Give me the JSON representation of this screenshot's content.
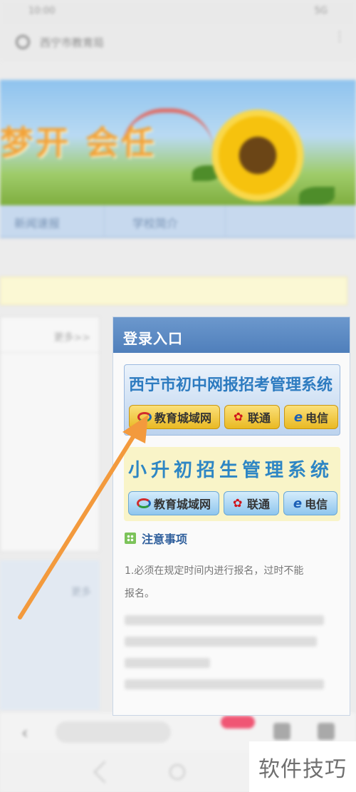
{
  "browser": {
    "status_time": "10:00",
    "status_right": "5G",
    "url": "西宁市教育局"
  },
  "banner": {
    "slogan": "梦开 会任"
  },
  "nav": {
    "tabs": [
      "新闻速报",
      "学校简介"
    ]
  },
  "left_panel": {
    "more_label": "更多>>",
    "more_label_2": "更多"
  },
  "login": {
    "header": "登录入口",
    "system1": {
      "title": "西宁市初中网报招考管理系统",
      "buttons": [
        "教育城域网",
        "联通",
        "电信"
      ]
    },
    "system2": {
      "title": "小升初招生管理系统",
      "buttons": [
        "教育城域网",
        "联通",
        "电信"
      ]
    },
    "notes": {
      "heading": "注意事项",
      "line1": "1.必须在规定时间内进行报名，过时不能",
      "line2": "报名。"
    }
  },
  "watermark": "软件技巧",
  "colors": {
    "accent_arrow": "#f39a3d",
    "login_header": "#5585c2",
    "system_title": "#2d7bc0"
  }
}
